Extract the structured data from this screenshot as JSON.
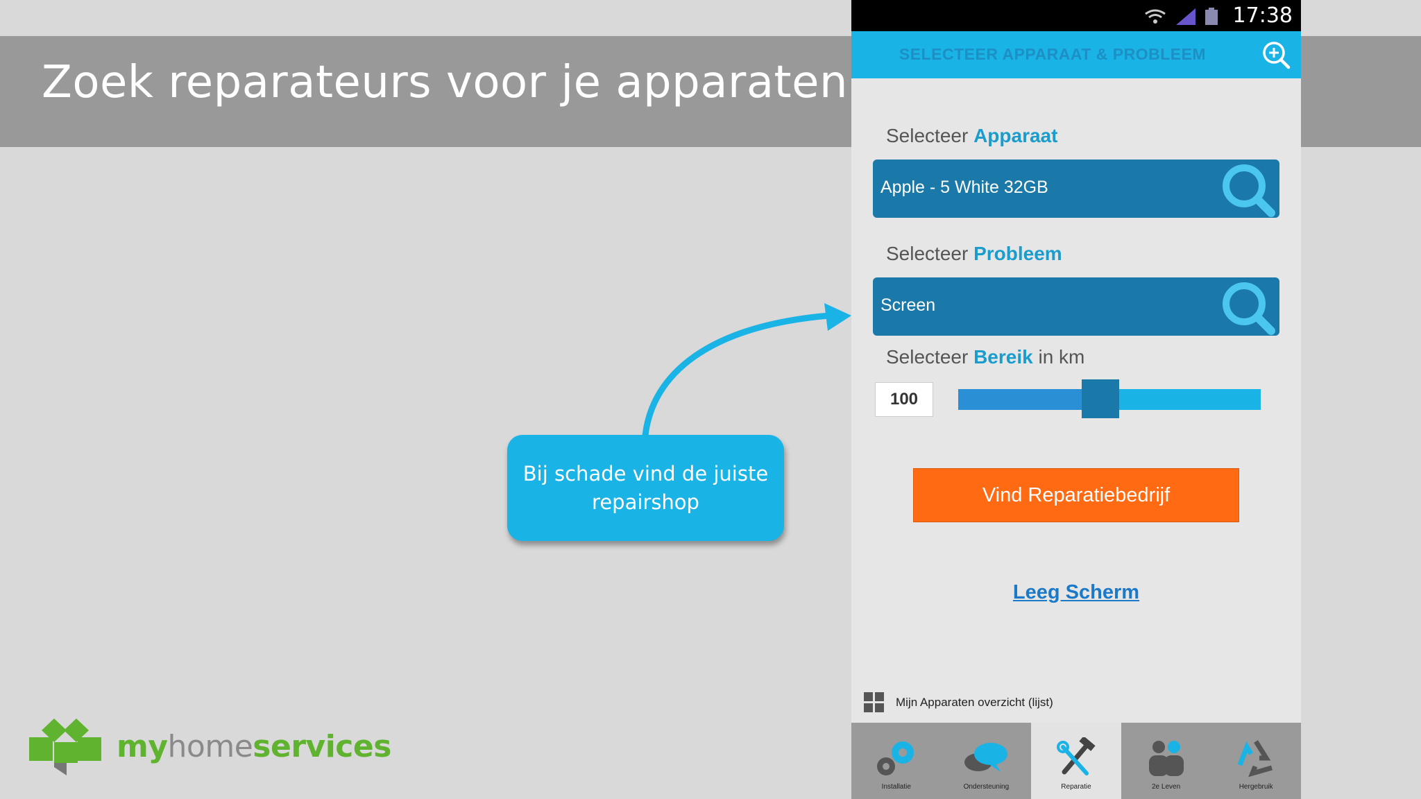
{
  "slide": {
    "title": "Zoek reparateurs voor je apparaten",
    "callout": "Bij schade vind de juiste repairshop",
    "logo": {
      "my": "my",
      "home": "home",
      "services": "services"
    }
  },
  "phone": {
    "status": {
      "time": "17:38"
    },
    "appbar": {
      "title": "SELECTEER APPARAAT & PROBLEEM",
      "zoom_icon": "zoom-in-icon"
    },
    "device": {
      "label_prefix": "Selecteer",
      "label_accent": "Apparaat",
      "value": "Apple - 5 White 32GB"
    },
    "problem": {
      "label_prefix": "Selecteer",
      "label_accent": "Probleem",
      "value": "Screen"
    },
    "range": {
      "label_prefix": "Selecteer",
      "label_accent": "Bereik",
      "label_suffix": "in km",
      "value": "100",
      "slider_fraction": 0.47
    },
    "find_button": "Vind Reparatiebedrijf",
    "clear_link": "Leeg Scherm",
    "overview": "Mijn Apparaten overzicht (lijst)",
    "nav": [
      {
        "label": "Installatie",
        "icon": "gears-icon",
        "active": false
      },
      {
        "label": "Ondersteuning",
        "icon": "speech-bubbles-icon",
        "active": false
      },
      {
        "label": "Reparatie",
        "icon": "tools-icon",
        "active": true
      },
      {
        "label": "2e Leven",
        "icon": "people-icon",
        "active": false
      },
      {
        "label": "Hergebruik",
        "icon": "recycle-icon",
        "active": false
      }
    ]
  },
  "colors": {
    "accent": "#1ab3e6",
    "field": "#1a79a8",
    "button": "#ff6a13",
    "logo_green": "#5fb32e"
  }
}
